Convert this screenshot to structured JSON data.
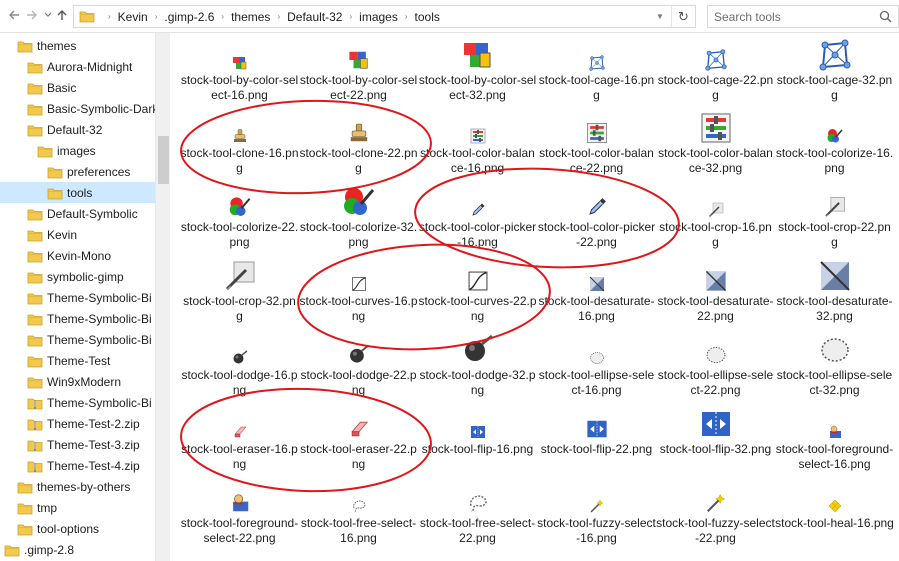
{
  "address_bar": {
    "crumbs": [
      "Kevin",
      ".gimp-2.6",
      "themes",
      "Default-32",
      "images",
      "tools"
    ]
  },
  "search": {
    "placeholder": "Search tools"
  },
  "sidebar": {
    "items": [
      {
        "label": "themes",
        "level": 1,
        "icon": "folder-icon"
      },
      {
        "label": "Aurora-Midnight",
        "level": 2,
        "icon": "folder-icon"
      },
      {
        "label": "Basic",
        "level": 2,
        "icon": "folder-icon"
      },
      {
        "label": "Basic-Symbolic-Dark",
        "level": 2,
        "icon": "folder-icon"
      },
      {
        "label": "Default-32",
        "level": 2,
        "icon": "folder-icon"
      },
      {
        "label": "images",
        "level": 3,
        "icon": "folder-icon"
      },
      {
        "label": "preferences",
        "level": 4,
        "icon": "folder-icon"
      },
      {
        "label": "tools",
        "level": 4,
        "icon": "folder-icon",
        "selected": true
      },
      {
        "label": "Default-Symbolic",
        "level": 2,
        "icon": "folder-icon"
      },
      {
        "label": "Kevin",
        "level": 2,
        "icon": "folder-icon"
      },
      {
        "label": "Kevin-Mono",
        "level": 2,
        "icon": "folder-icon"
      },
      {
        "label": "symbolic-gimp",
        "level": 2,
        "icon": "folder-icon"
      },
      {
        "label": "Theme-Symbolic-Bi",
        "level": 2,
        "icon": "folder-icon"
      },
      {
        "label": "Theme-Symbolic-Bi",
        "level": 2,
        "icon": "folder-icon"
      },
      {
        "label": "Theme-Symbolic-Bi",
        "level": 2,
        "icon": "folder-icon"
      },
      {
        "label": "Theme-Test",
        "level": 2,
        "icon": "folder-icon"
      },
      {
        "label": "Win9xModern",
        "level": 2,
        "icon": "folder-icon"
      },
      {
        "label": "Theme-Symbolic-Bi",
        "level": 2,
        "icon": "zip-folder-icon"
      },
      {
        "label": "Theme-Test-2.zip",
        "level": 2,
        "icon": "zip-folder-icon"
      },
      {
        "label": "Theme-Test-3.zip",
        "level": 2,
        "icon": "zip-folder-icon"
      },
      {
        "label": "Theme-Test-4.zip",
        "level": 2,
        "icon": "zip-folder-icon"
      },
      {
        "label": "themes-by-others",
        "level": 1,
        "icon": "folder-icon"
      },
      {
        "label": "tmp",
        "level": 1,
        "icon": "folder-icon"
      },
      {
        "label": "tool-options",
        "level": 1,
        "icon": "folder-icon"
      },
      {
        "label": ".gimp-2.8",
        "level": 0,
        "icon": "folder-icon"
      }
    ]
  },
  "files": [
    {
      "name": "stock-tool-by-color-select-16.png",
      "icon": "by-color-select-icon",
      "size": 16
    },
    {
      "name": "stock-tool-by-color-select-22.png",
      "icon": "by-color-select-icon",
      "size": 22
    },
    {
      "name": "stock-tool-by-color-select-32.png",
      "icon": "by-color-select-icon",
      "size": 32
    },
    {
      "name": "stock-tool-cage-16.png",
      "icon": "cage-icon",
      "size": 16
    },
    {
      "name": "stock-tool-cage-22.png",
      "icon": "cage-icon",
      "size": 22
    },
    {
      "name": "stock-tool-cage-32.png",
      "icon": "cage-icon",
      "size": 32
    },
    {
      "name": "stock-tool-clone-16.png",
      "icon": "clone-icon",
      "size": 16
    },
    {
      "name": "stock-tool-clone-22.png",
      "icon": "clone-icon",
      "size": 22
    },
    {
      "name": "stock-tool-color-balance-16.png",
      "icon": "color-balance-icon",
      "size": 16
    },
    {
      "name": "stock-tool-color-balance-22.png",
      "icon": "color-balance-icon",
      "size": 22
    },
    {
      "name": "stock-tool-color-balance-32.png",
      "icon": "color-balance-icon",
      "size": 32
    },
    {
      "name": "stock-tool-colorize-16.png",
      "icon": "colorize-icon",
      "size": 16
    },
    {
      "name": "stock-tool-colorize-22.png",
      "icon": "colorize-icon",
      "size": 22
    },
    {
      "name": "stock-tool-colorize-32.png",
      "icon": "colorize-icon",
      "size": 32
    },
    {
      "name": "stock-tool-color-picker-16.png",
      "icon": "color-picker-icon",
      "size": 16
    },
    {
      "name": "stock-tool-color-picker-22.png",
      "icon": "color-picker-icon",
      "size": 22
    },
    {
      "name": "stock-tool-crop-16.png",
      "icon": "crop-icon",
      "size": 16
    },
    {
      "name": "stock-tool-crop-22.png",
      "icon": "crop-icon",
      "size": 22
    },
    {
      "name": "stock-tool-crop-32.png",
      "icon": "crop-icon",
      "size": 32
    },
    {
      "name": "stock-tool-curves-16.png",
      "icon": "curves-icon",
      "size": 16
    },
    {
      "name": "stock-tool-curves-22.png",
      "icon": "curves-icon",
      "size": 22
    },
    {
      "name": "stock-tool-desaturate-16.png",
      "icon": "desaturate-icon",
      "size": 16
    },
    {
      "name": "stock-tool-desaturate-22.png",
      "icon": "desaturate-icon",
      "size": 22
    },
    {
      "name": "stock-tool-desaturate-32.png",
      "icon": "desaturate-icon",
      "size": 32
    },
    {
      "name": "stock-tool-dodge-16.png",
      "icon": "dodge-icon",
      "size": 16
    },
    {
      "name": "stock-tool-dodge-22.png",
      "icon": "dodge-icon",
      "size": 22
    },
    {
      "name": "stock-tool-dodge-32.png",
      "icon": "dodge-icon",
      "size": 32
    },
    {
      "name": "stock-tool-ellipse-select-16.png",
      "icon": "ellipse-select-icon",
      "size": 16
    },
    {
      "name": "stock-tool-ellipse-select-22.png",
      "icon": "ellipse-select-icon",
      "size": 22
    },
    {
      "name": "stock-tool-ellipse-select-32.png",
      "icon": "ellipse-select-icon",
      "size": 32
    },
    {
      "name": "stock-tool-eraser-16.png",
      "icon": "eraser-icon",
      "size": 16
    },
    {
      "name": "stock-tool-eraser-22.png",
      "icon": "eraser-icon",
      "size": 22
    },
    {
      "name": "stock-tool-flip-16.png",
      "icon": "flip-icon",
      "size": 16
    },
    {
      "name": "stock-tool-flip-22.png",
      "icon": "flip-icon",
      "size": 22
    },
    {
      "name": "stock-tool-flip-32.png",
      "icon": "flip-icon",
      "size": 32
    },
    {
      "name": "stock-tool-foreground-select-16.png",
      "icon": "foreground-select-icon",
      "size": 16
    },
    {
      "name": "stock-tool-foreground-select-22.png",
      "icon": "foreground-select-icon",
      "size": 22
    },
    {
      "name": "stock-tool-free-select-16.png",
      "icon": "free-select-icon",
      "size": 16
    },
    {
      "name": "stock-tool-free-select-22.png",
      "icon": "free-select-icon",
      "size": 22
    },
    {
      "name": "stock-tool-fuzzy-select-16.png",
      "icon": "fuzzy-select-icon",
      "size": 16
    },
    {
      "name": "stock-tool-fuzzy-select-22.png",
      "icon": "fuzzy-select-icon",
      "size": 22
    },
    {
      "name": "stock-tool-heal-16.png",
      "icon": "heal-icon",
      "size": 16
    }
  ],
  "annotations": {
    "highlight_color": "#e0161b",
    "circled_files": [
      "stock-tool-clone",
      "stock-tool-color-picker",
      "stock-tool-curves",
      "stock-tool-eraser"
    ]
  },
  "colors": {
    "selected_bg": "#cde8ff",
    "folder_yellow": "#f2c94c"
  }
}
